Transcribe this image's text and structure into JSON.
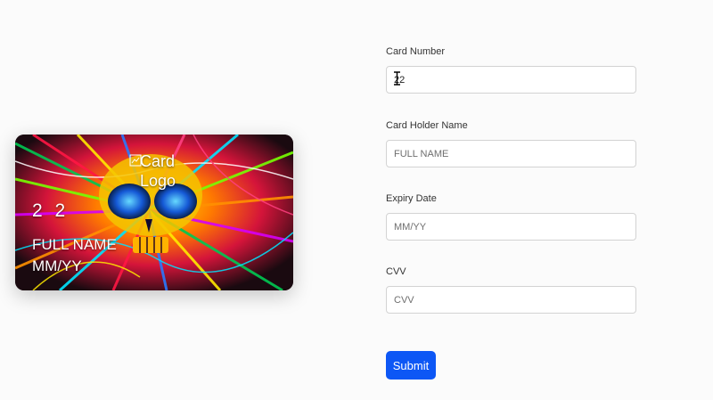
{
  "card": {
    "logo_alt": "Card Logo",
    "number": "2 2",
    "holder": "FULL NAME",
    "expiry": "MM/YY"
  },
  "form": {
    "card_number": {
      "label": "Card Number",
      "value": "22",
      "placeholder": ""
    },
    "card_holder": {
      "label": "Card Holder Name",
      "value": "",
      "placeholder": "FULL NAME"
    },
    "expiry": {
      "label": "Expiry Date",
      "value": "",
      "placeholder": "MM/YY"
    },
    "cvv": {
      "label": "CVV",
      "value": "",
      "placeholder": "CVV"
    },
    "submit_label": "Submit"
  },
  "colors": {
    "page_background": "#fbfbfb",
    "submit_button": "#0d57f5",
    "input_border": "#d3d3d3"
  },
  "icons": {
    "text_cursor": "i-beam-cursor-icon",
    "broken_image": "broken-image-icon"
  }
}
